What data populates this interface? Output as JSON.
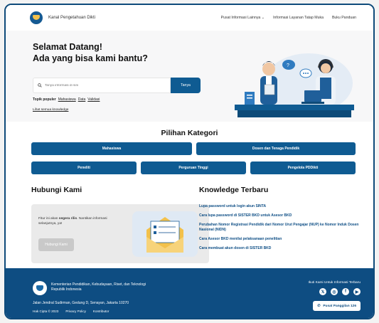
{
  "header": {
    "brand": "Kanal Pengetahuan Dikti",
    "nav": [
      "Pusat Informasi Lainnya",
      "Informasi Layanan Tatap Muka",
      "Buku Panduan"
    ]
  },
  "hero": {
    "title_line1": "Selamat Datang!",
    "title_line2": "Ada yang bisa kami bantu?",
    "search_placeholder": "Tanya informasi di sini",
    "search_button": "Tanya",
    "popular_label": "Topik populer",
    "popular_topics": [
      "Mahasiswa",
      "Data",
      "Validasi"
    ],
    "all_knowledge": "Lihat semua knowledge"
  },
  "categories": {
    "title": "Pilihan Kategori",
    "row1": [
      "Mahasiswa",
      "Dosen dan Tenaga Pendidik"
    ],
    "row2": [
      "Peneliti",
      "Perguruan Tinggi",
      "Pengelola PDDikti"
    ]
  },
  "contact": {
    "title": "Hubungi Kami",
    "text_pre": "Fitur ini akan ",
    "text_bold": "segera rilis",
    "text_post": ". Nantikan informasi selanjutnya, ya!",
    "button": "Hubungi Kami"
  },
  "knowledge": {
    "title": "Knowledge Terbaru",
    "items": [
      "Lupa password untuk login akun SINTA",
      "Cara lupa password di SISTER BKD untuk Asesor BKD",
      "Perubahan Nomor Registrasi Pendidik dari Nomor Urut Pengajar (NUP) ke Nomor Induk Dosen Nasional (NIDN)",
      "Cara Asesor BKD menilai pelaksanaan penelitian",
      "Cara membuat akun dosen di SISTER BKD"
    ]
  },
  "footer": {
    "org": "Kementerian Pendidikan, Kebudayaan, Riset, dan Teknologi Republik Indonesia",
    "address": "Jalan Jendral Sudirman, Gedung D, Senayan, Jakarta 10270",
    "copyright": "Hak Cipta © 2023",
    "privacy": "Privacy Policy",
    "contributor": "Kontributor",
    "follow": "Ikuti Kami Untuk Informasi Terbaru",
    "call": "Pusat Panggilan 126"
  },
  "colors": {
    "primary": "#0f5b92",
    "footer": "#0e4d82",
    "link": "#0f4f86"
  }
}
